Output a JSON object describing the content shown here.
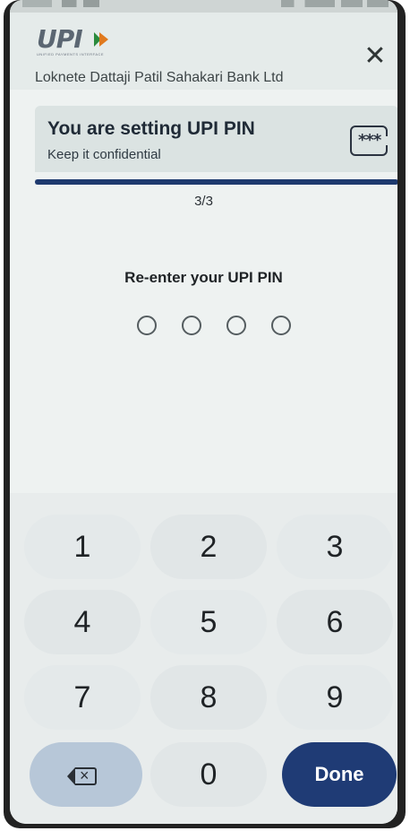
{
  "header": {
    "logo_text": "UPI",
    "logo_tagline": "UNIFIED PAYMENTS INTERFACE",
    "bank_name": "Loknete Dattaji Patil Sahakari Bank Ltd",
    "close_symbol": "✕"
  },
  "info_card": {
    "title": "You are setting UPI PIN",
    "subtitle": "Keep it confidential",
    "pin_icon_text": "***"
  },
  "progress": {
    "step_text": "3/3",
    "fraction": 1.0
  },
  "pin_entry": {
    "label": "Re-enter your UPI PIN",
    "digits_entered": 0,
    "digits_total": 4
  },
  "keypad": {
    "keys": [
      "1",
      "2",
      "3",
      "4",
      "5",
      "6",
      "7",
      "8",
      "9"
    ],
    "zero": "0",
    "done_label": "Done",
    "backspace_icon": "backspace-icon"
  },
  "colors": {
    "primary": "#1f3b75",
    "upi_orange": "#e07a1f",
    "upi_green": "#2a8a3c"
  }
}
